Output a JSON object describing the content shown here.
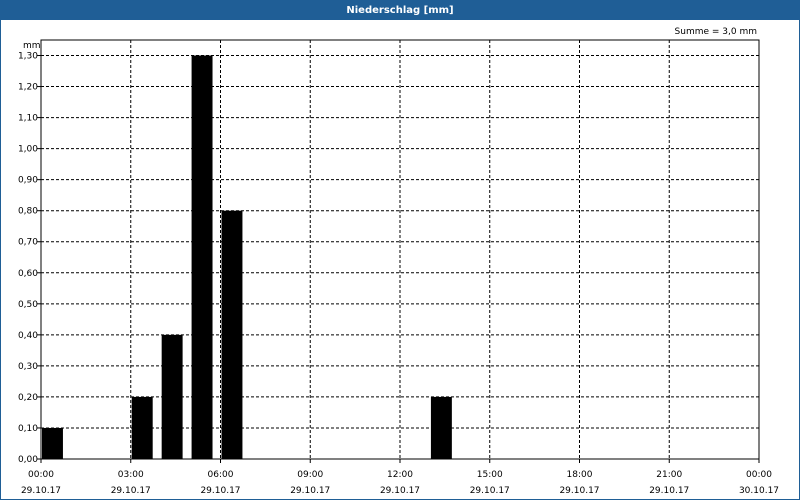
{
  "window": {
    "title": "Niederschlag [mm]"
  },
  "annotation": "Summe = 3,0 mm",
  "chart_data": {
    "type": "bar",
    "title": "Niederschlag [mm]",
    "ylabel": "mm",
    "xlabel": "",
    "ylim": [
      0,
      1.35
    ],
    "yticks": [
      "0,00",
      "0,10",
      "0,20",
      "0,30",
      "0,40",
      "0,50",
      "0,60",
      "0,70",
      "0,80",
      "0,90",
      "1,00",
      "1,10",
      "1,20",
      "1,30"
    ],
    "xticks": [
      {
        "time": "00:00",
        "date": "29.10.17"
      },
      {
        "time": "03:00",
        "date": "29.10.17"
      },
      {
        "time": "06:00",
        "date": "29.10.17"
      },
      {
        "time": "09:00",
        "date": "29.10.17"
      },
      {
        "time": "12:00",
        "date": "29.10.17"
      },
      {
        "time": "15:00",
        "date": "29.10.17"
      },
      {
        "time": "18:00",
        "date": "29.10.17"
      },
      {
        "time": "21:00",
        "date": "29.10.17"
      },
      {
        "time": "00:00",
        "date": "30.10.17"
      }
    ],
    "grid": true,
    "bar_color": "#000000",
    "series": [
      {
        "values": [
          {
            "x": "29.10.17 00:00",
            "y": 0.1
          },
          {
            "x": "29.10.17 03:00",
            "y": 0.2
          },
          {
            "x": "29.10.17 04:00",
            "y": 0.4
          },
          {
            "x": "29.10.17 05:00",
            "y": 1.3
          },
          {
            "x": "29.10.17 06:00",
            "y": 0.8
          },
          {
            "x": "29.10.17 13:00",
            "y": 0.2
          }
        ]
      }
    ]
  }
}
